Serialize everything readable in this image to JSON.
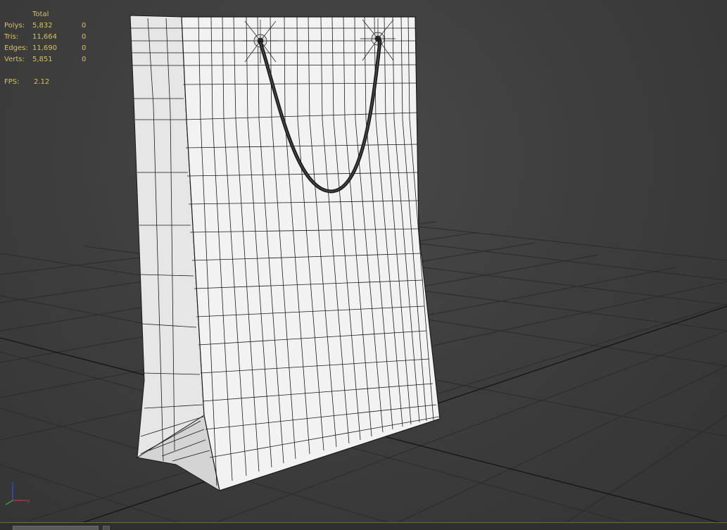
{
  "stats": {
    "header": "Total",
    "rows": [
      {
        "label": "Polys:",
        "total": "5,832",
        "selected": "0"
      },
      {
        "label": "Tris:",
        "total": "11,664",
        "selected": "0"
      },
      {
        "label": "Edges:",
        "total": "11,690",
        "selected": "0"
      },
      {
        "label": "Verts:",
        "total": "5,851",
        "selected": "0"
      }
    ],
    "fps_label": "FPS:",
    "fps_value": "2.12"
  },
  "gizmo": {
    "x_label": "x",
    "y_label": "y",
    "z_label": "z",
    "x_color": "#d03030",
    "y_color": "#30c030",
    "z_color": "#3050e0"
  },
  "colors": {
    "stats_text": "#d8c060",
    "grid_line": "#2a2a2a",
    "grid_main": "#151515",
    "model_face": "#f0f0f0",
    "wire": "#1a1a1a"
  }
}
